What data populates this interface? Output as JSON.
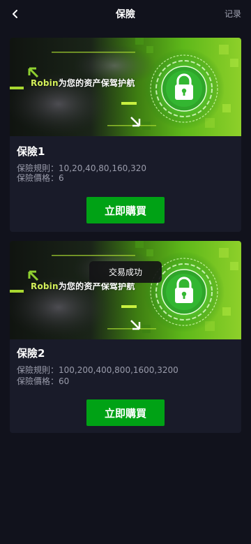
{
  "header": {
    "title": "保險",
    "right_link": "记录",
    "back_icon": "chevron-left-icon"
  },
  "banner": {
    "brand": "Robin",
    "slogan": "为您的资产保驾护航",
    "icon": "padlock-icon"
  },
  "cards": [
    {
      "title": "保險1",
      "rule_label": "保險規則：",
      "rule_value": "10,20,40,80,160,320",
      "price_label": "保險價格：",
      "price_value": "6",
      "buy_label": "立即購買"
    },
    {
      "title": "保險2",
      "rule_label": "保險規則：",
      "rule_value": "100,200,400,800,1600,3200",
      "price_label": "保險價格：",
      "price_value": "60",
      "buy_label": "立即購買"
    }
  ],
  "toast": {
    "text": "交易成功"
  },
  "colors": {
    "background": "#11121c",
    "card": "#191b29",
    "accent_green": "#00a215",
    "muted_text": "#9a9cab"
  }
}
